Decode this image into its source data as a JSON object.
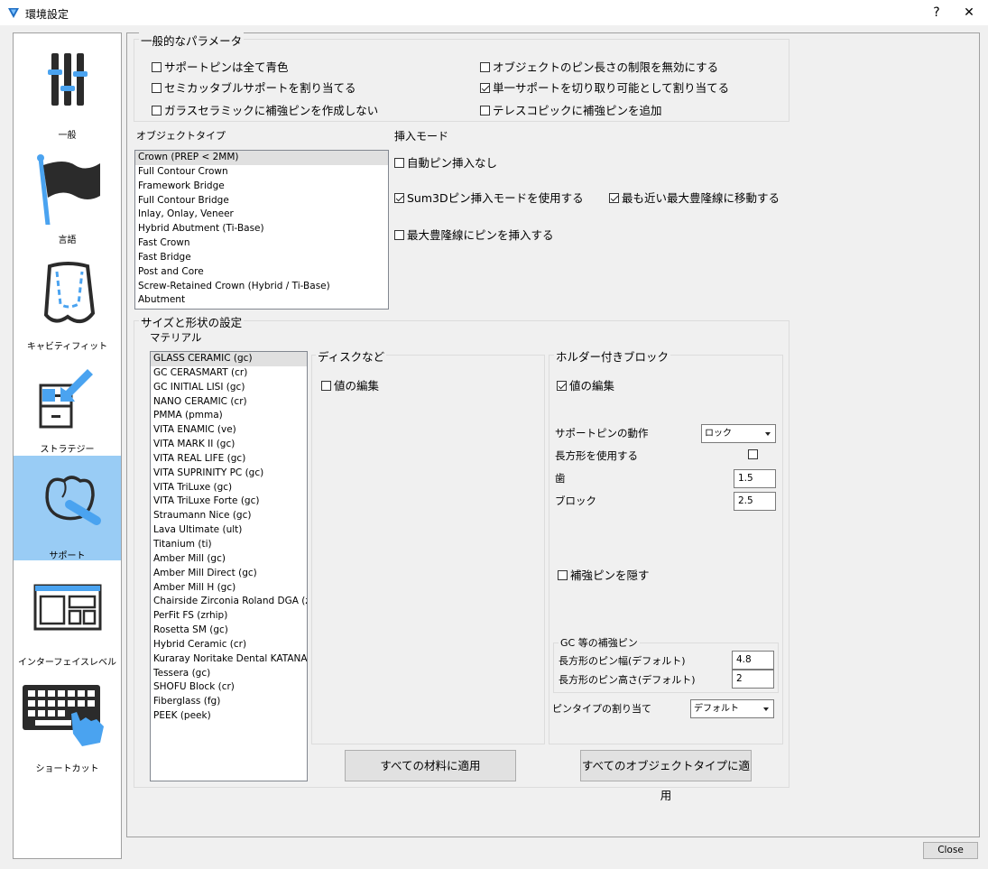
{
  "window": {
    "title": "環境設定",
    "help_label": "?",
    "close_glyph": "✕"
  },
  "sidebar": {
    "items": [
      {
        "label": "一般",
        "icon": "sliders-icon",
        "selected": false
      },
      {
        "label": "言語",
        "icon": "flag-icon",
        "selected": false
      },
      {
        "label": "キャビティフィット",
        "icon": "cavity-fit-icon",
        "selected": false
      },
      {
        "label": "ストラテジー",
        "icon": "strategy-icon",
        "selected": false
      },
      {
        "label": "サポート",
        "icon": "support-tooth-icon",
        "selected": true
      },
      {
        "label": "インターフェイスレベル",
        "icon": "interface-layout-icon",
        "selected": false
      },
      {
        "label": "ショートカット",
        "icon": "keyboard-icon",
        "selected": false
      }
    ]
  },
  "general_params": {
    "title": "一般的なパラメータ",
    "checkboxes": [
      {
        "label": "サポートピンは全て青色",
        "checked": false
      },
      {
        "label": "セミカッタブルサポートを割り当てる",
        "checked": false
      },
      {
        "label": "ガラスセラミックに補強ピンを作成しない",
        "checked": false
      },
      {
        "label": "オブジェクトのピン長さの制限を無効にする",
        "checked": false
      },
      {
        "label": "単一サポートを切り取り可能として割り当てる",
        "checked": true
      },
      {
        "label": "テレスコピックに補強ピンを追加",
        "checked": false
      }
    ]
  },
  "object_type": {
    "title": "オブジェクトタイプ",
    "items": [
      "Crown (PREP < 2MM)",
      "Full Contour Crown",
      "Framework Bridge",
      "Full Contour Bridge",
      "Inlay, Onlay, Veneer",
      "Hybrid Abutment (Ti-Base)",
      "Fast Crown",
      "Fast Bridge",
      "Post and Core",
      "Screw-Retained Crown (Hybrid / Ti-Base)",
      "Abutment"
    ],
    "selected_index": 0
  },
  "insert_mode": {
    "title": "挿入モード",
    "checkboxes": [
      {
        "label": "自動ピン挿入なし",
        "checked": false
      },
      {
        "label": "Sum3Dピン挿入モードを使用する",
        "checked": true
      },
      {
        "label": "最も近い最大豊隆線に移動する",
        "checked": true
      },
      {
        "label": "最大豊隆線にピンを挿入する",
        "checked": false
      }
    ]
  },
  "size_shape": {
    "title": "サイズと形状の設定",
    "material_title": "マテリアル",
    "materials": [
      "GLASS CERAMIC (gc)",
      "GC CERASMART (cr)",
      "GC INITIAL LISI (gc)",
      "NANO CERAMIC (cr)",
      "PMMA (pmma)",
      "VITA ENAMIC (ve)",
      "VITA MARK II (gc)",
      "VITA REAL LIFE (gc)",
      "VITA SUPRINITY PC (gc)",
      "VITA TriLuxe (gc)",
      "VITA TriLuxe Forte (gc)",
      "Straumann Nice (gc)",
      "Lava Ultimate (ult)",
      "Titanium (ti)",
      "Amber Mill (gc)",
      "Amber Mill Direct (gc)",
      "Amber Mill H (gc)",
      "Chairside Zirconia Roland DGA (zrh",
      "PerFit FS (zrhip)",
      "Rosetta SM (gc)",
      "Hybrid Ceramic (cr)",
      "Kuraray Noritake Dental KATANA (",
      "Tessera (gc)",
      "SHOFU Block (cr)",
      "Fiberglass (fg)",
      "PEEK (peek)"
    ],
    "selected_index": 0,
    "disc": {
      "title": "ディスクなど",
      "edit_label": "値の編集",
      "edit_checked": false
    },
    "holder": {
      "title": "ホルダー付きブロック",
      "edit_label": "値の編集",
      "edit_checked": true,
      "support_pin_action_label": "サポートピンの動作",
      "support_pin_action_value": "ロック",
      "use_rectangle_label": "長方形を使用する",
      "use_rectangle_checked": false,
      "tooth_label": "歯",
      "tooth_value": "1.5",
      "block_label": "ブロック",
      "block_value": "2.5",
      "hide_pins_label": "補強ピンを隠す",
      "hide_pins_checked": false,
      "gc_title": "GC 等の補強ピン",
      "rect_width_label": "長方形のピン幅(デフォルト)",
      "rect_width_value": "4.8",
      "rect_height_label": "長方形のピン高さ(デフォルト)",
      "rect_height_value": "2",
      "pin_type_label": "ピンタイプの割り当て",
      "pin_type_value": "デフォルト"
    },
    "apply_all_materials": "すべての材料に適用",
    "apply_all_object_types": "すべてのオブジェクトタイプに適用"
  },
  "footer": {
    "close_label": "Close"
  },
  "colors": {
    "selected_sidebar": "#99ccf5",
    "icon_dark": "#2b2b2b",
    "icon_blue": "#4aa3f0"
  }
}
